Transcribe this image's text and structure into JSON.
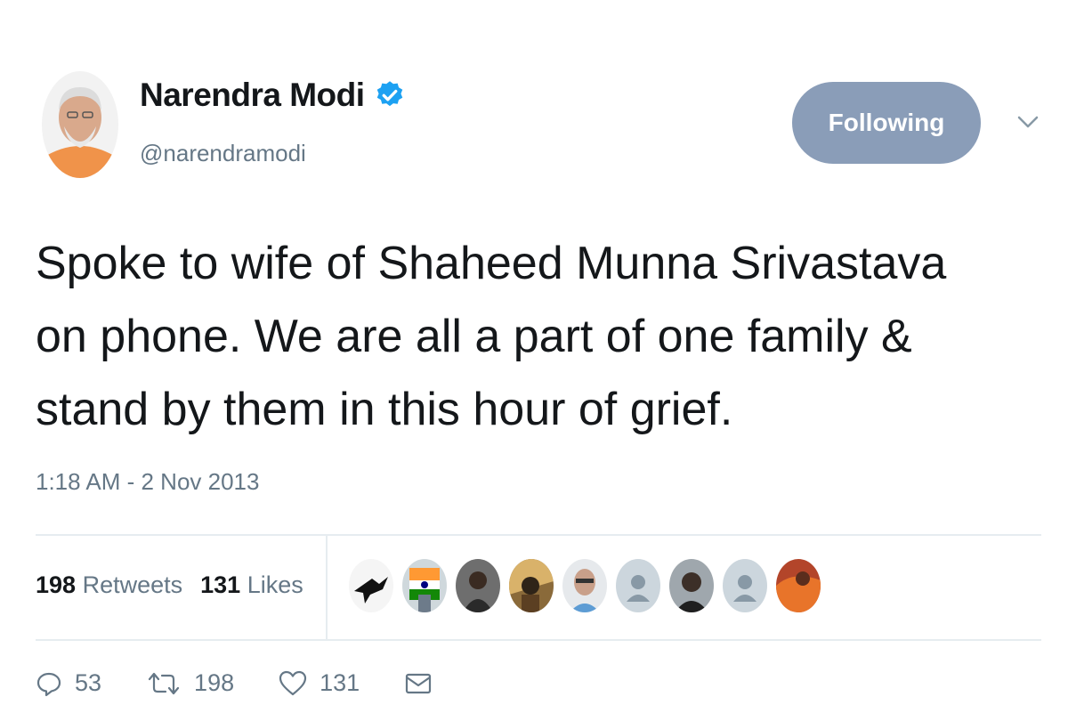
{
  "user": {
    "name": "Narendra Modi",
    "handle": "@narendramodi",
    "verified": true,
    "follow_label": "Following"
  },
  "tweet": {
    "line1": "Spoke to wife of Shaheed Munna Srivastava",
    "line2": "on phone. We are all a part of one family &",
    "line3": "stand by them in this hour of grief.",
    "timestamp": "1:18 AM - 2 Nov 2013"
  },
  "stats": {
    "retweets_count": "198",
    "retweets_label": "Retweets",
    "likes_count": "131",
    "likes_label": "Likes"
  },
  "actions": {
    "reply_count": "53",
    "retweet_count": "198",
    "like_count": "131"
  },
  "colors": {
    "verified": "#1da1f2",
    "follow_button": "#8a9db8",
    "secondary_text": "#657786"
  },
  "icons": [
    "verified-badge-icon",
    "chevron-down-icon",
    "reply-icon",
    "retweet-icon",
    "heart-icon",
    "envelope-icon"
  ]
}
